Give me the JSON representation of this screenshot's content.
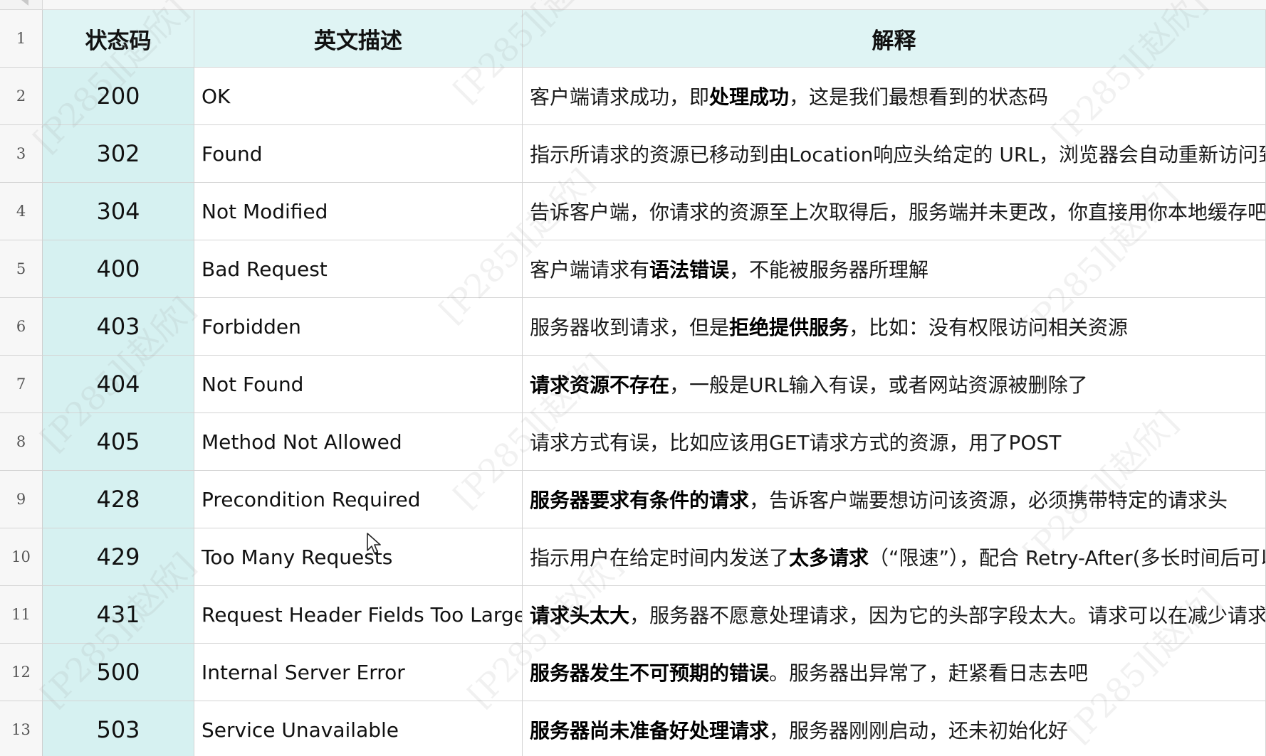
{
  "headers": {
    "code": "状态码",
    "desc": "英文描述",
    "expl": "解释"
  },
  "row_numbers": [
    "1",
    "2",
    "3",
    "4",
    "5",
    "6",
    "7",
    "8",
    "9",
    "10",
    "11",
    "12",
    "13"
  ],
  "rows": [
    {
      "code": "200",
      "desc": "OK",
      "expl": [
        {
          "t": "客户端请求成功，即"
        },
        {
          "t": "处理成功",
          "b": true
        },
        {
          "t": "，这是我们最想看到的状态码"
        }
      ]
    },
    {
      "code": "302",
      "desc": "Found",
      "expl": [
        {
          "t": "指示所请求的资源已移动到由Location响应头给定的 URL，浏览器会自动重新访问到这个页面"
        }
      ]
    },
    {
      "code": "304",
      "desc": "Not Modified",
      "expl": [
        {
          "t": "告诉客户端，你请求的资源至上次取得后，服务端并未更改，你直接用你本地缓存吧。隐式重定向"
        }
      ]
    },
    {
      "code": "400",
      "desc": "Bad Request",
      "expl": [
        {
          "t": "客户端请求有"
        },
        {
          "t": "语法错误",
          "b": true
        },
        {
          "t": "，不能被服务器所理解"
        }
      ]
    },
    {
      "code": "403",
      "desc": "Forbidden",
      "expl": [
        {
          "t": "服务器收到请求，但是"
        },
        {
          "t": "拒绝提供服务",
          "b": true
        },
        {
          "t": "，比如：没有权限访问相关资源"
        }
      ]
    },
    {
      "code": "404",
      "desc": "Not Found",
      "expl": [
        {
          "t": "请求资源不存在",
          "b": true
        },
        {
          "t": "，一般是URL输入有误，或者网站资源被删除了"
        }
      ]
    },
    {
      "code": "405",
      "desc": "Method Not Allowed",
      "expl": [
        {
          "t": "请求方式有误，比如应该用GET请求方式的资源，用了POST"
        }
      ]
    },
    {
      "code": "428",
      "desc": "Precondition Required",
      "expl": [
        {
          "t": "服务器要求有条件的请求",
          "b": true
        },
        {
          "t": "，告诉客户端要想访问该资源，必须携带特定的请求头"
        }
      ]
    },
    {
      "code": "429",
      "desc": "Too Many Requests",
      "expl": [
        {
          "t": "指示用户在给定时间内发送了"
        },
        {
          "t": "太多请求",
          "b": true
        },
        {
          "t": "（“限速”），配合 Retry-After(多长时间后可以请求)响应头一起使用"
        }
      ]
    },
    {
      "code": "431",
      "desc": "Request Header Fields Too Large",
      "expl": [
        {
          "t": "请求头太大",
          "b": true
        },
        {
          "t": "，服务器不愿意处理请求，因为它的头部字段太大。请求可以在减少请求头域的大小后重新提交。"
        }
      ]
    },
    {
      "code": "500",
      "desc": "Internal Server Error",
      "expl": [
        {
          "t": "服务器发生不可预期的错误",
          "b": true
        },
        {
          "t": "。服务器出异常了，赶紧看日志去吧"
        }
      ]
    },
    {
      "code": "503",
      "desc": "Service Unavailable",
      "expl": [
        {
          "t": "服务器尚未准备好处理请求",
          "b": true
        },
        {
          "t": "，服务器刚刚启动，还未初始化好"
        }
      ]
    }
  ],
  "watermark": "[P285][赵欣]",
  "colors": {
    "header_bg": "#dff4f4",
    "code_bg": "#d6f1f1",
    "grid_line": "#d4d4d4"
  },
  "icons": {
    "cursor": "mouse-pointer-icon"
  }
}
